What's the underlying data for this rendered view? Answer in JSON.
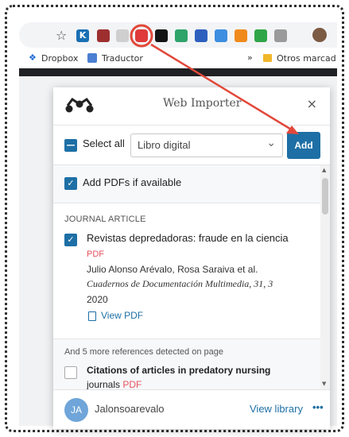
{
  "colors": {
    "accent": "#1d6fa5",
    "pdf_badge": "#e5535e",
    "annotation": "#e2483a"
  },
  "browser": {
    "star_icon": "star-icon",
    "extensions": [
      "K",
      "",
      "",
      "",
      "",
      "",
      "",
      "",
      "",
      "",
      ""
    ],
    "bookmarks": {
      "dropbox": "Dropbox",
      "traductor": "Traductor",
      "overflow": "»",
      "other": "Otros marcad"
    }
  },
  "popup": {
    "title": "Web Importer",
    "close": "×",
    "select_all": "Select all",
    "collection": "Libro digital",
    "chevron": "⌄",
    "add": "Add",
    "add_pdfs": "Add PDFs if available",
    "item_type": "JOURNAL ARTICLE",
    "item": {
      "title": "Revistas depredadoras: fraude en la ciencia",
      "pdf_badge": "PDF",
      "authors": "Julio Alonso Arévalo, Rosa Saraiva et al.",
      "journal": "Cuadernos de Documentación Multimedia, 31, 3",
      "year": "2020",
      "view_pdf": "View PDF"
    },
    "more_refs": "And 5 more references detected on page",
    "item2": {
      "title": "Citations of articles in predatory nursing",
      "subtitle": "journals",
      "pdf_badge": "PDF"
    },
    "footer": {
      "avatar": "JA",
      "username": "Jalonsoarevalo",
      "view_library": "View library",
      "more": "•••"
    }
  }
}
